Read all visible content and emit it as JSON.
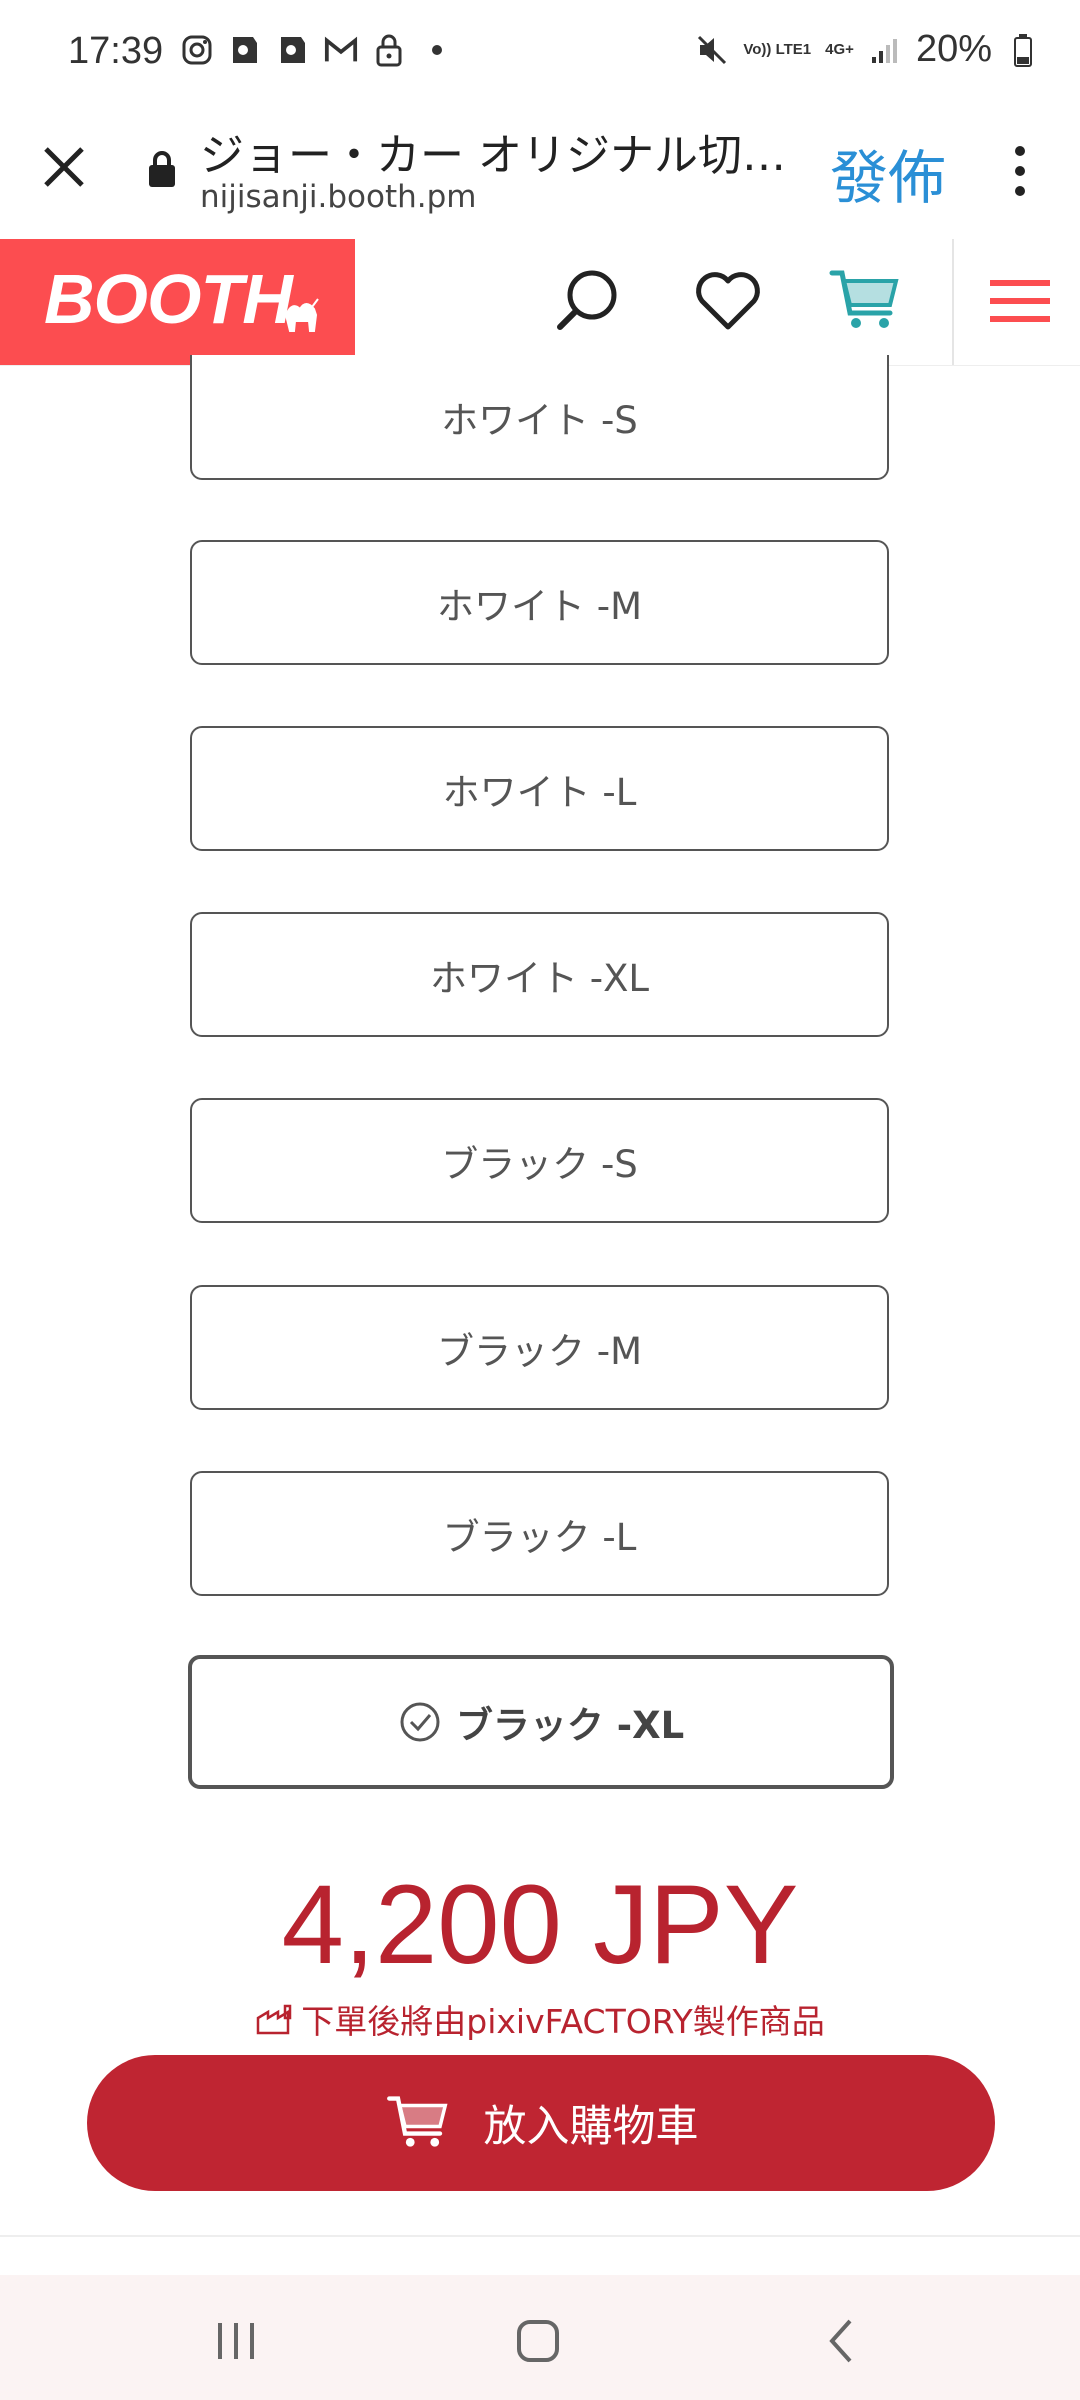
{
  "status_bar": {
    "time": "17:39",
    "network_volte": "Vo)) LTE1",
    "network_4g": "4G+",
    "battery": "20%"
  },
  "browser": {
    "page_title": "ジョー・カー オリジナル切り…",
    "url": "nijisanji.booth.pm",
    "translate_label": "發佈"
  },
  "header": {
    "logo_text": "BOOTH"
  },
  "variants": [
    {
      "label": "ホワイト -S",
      "selected": false
    },
    {
      "label": "ホワイト -M",
      "selected": false
    },
    {
      "label": "ホワイト -L",
      "selected": false
    },
    {
      "label": "ホワイト -XL",
      "selected": false
    },
    {
      "label": "ブラック -S",
      "selected": false
    },
    {
      "label": "ブラック -M",
      "selected": false
    },
    {
      "label": "ブラック -L",
      "selected": false
    },
    {
      "label": "ブラック -XL",
      "selected": true
    }
  ],
  "price": "4,200 JPY",
  "factory_note": "下單後將由pixivFACTORY製作商品",
  "cart_button_label": "放入購物車",
  "colors": {
    "brand": "#fc4d50",
    "price": "#b8232f",
    "cart_button": "#bf2532",
    "cart_icon": "#2aa3a8",
    "translate": "#2a8fd6"
  }
}
